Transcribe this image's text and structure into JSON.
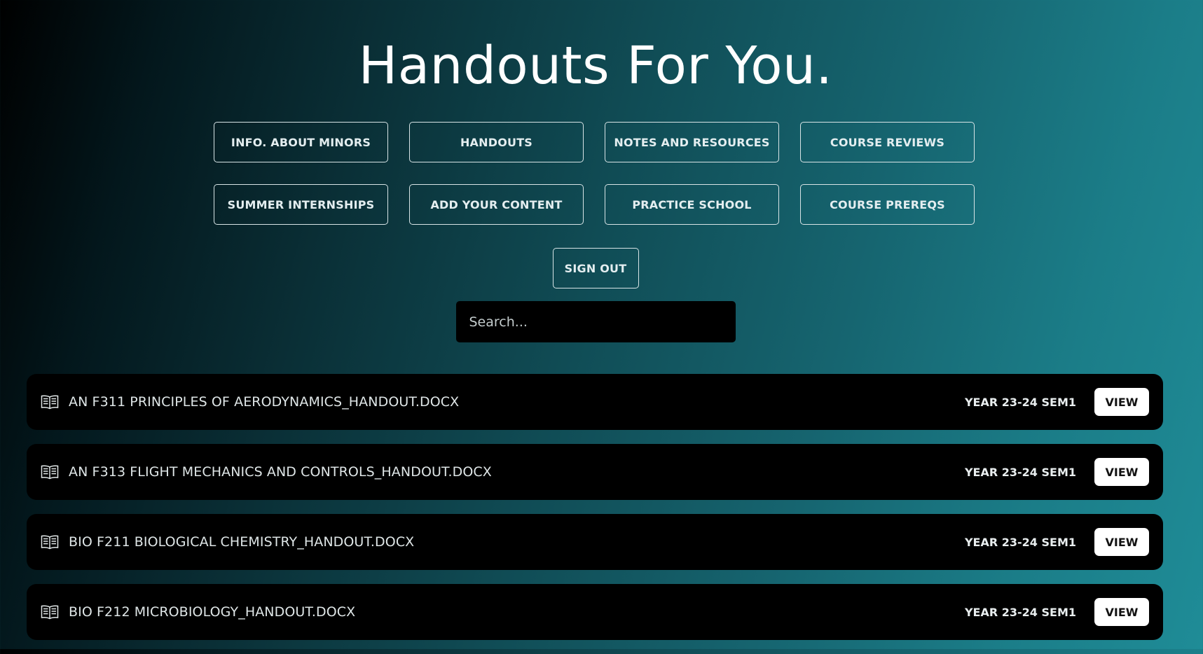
{
  "header": {
    "title": "Handouts For You."
  },
  "nav": {
    "buttons": [
      {
        "label": "INFO. ABOUT MINORS"
      },
      {
        "label": "HANDOUTS"
      },
      {
        "label": "NOTES AND RESOURCES"
      },
      {
        "label": "COURSE REVIEWS"
      },
      {
        "label": "SUMMER INTERNSHIPS"
      },
      {
        "label": "ADD YOUR CONTENT"
      },
      {
        "label": "PRACTICE SCHOOL"
      },
      {
        "label": "COURSE PREREQS"
      }
    ],
    "sign_out_label": "SIGN OUT"
  },
  "search": {
    "placeholder": "Search...",
    "value": ""
  },
  "handouts": [
    {
      "name": "AN F311 PRINCIPLES OF AERODYNAMICS_HANDOUT.DOCX",
      "term": "YEAR 23-24 SEM1",
      "action": "VIEW",
      "icon": "book-icon"
    },
    {
      "name": "AN F313 FLIGHT MECHANICS AND CONTROLS_HANDOUT.DOCX",
      "term": "YEAR 23-24 SEM1",
      "action": "VIEW",
      "icon": "book-icon"
    },
    {
      "name": "BIO F211 BIOLOGICAL CHEMISTRY_HANDOUT.DOCX",
      "term": "YEAR 23-24 SEM1",
      "action": "VIEW",
      "icon": "book-icon"
    },
    {
      "name": "BIO F212 MICROBIOLOGY_HANDOUT.DOCX",
      "term": "YEAR 23-24 SEM1",
      "action": "VIEW",
      "icon": "book-icon"
    }
  ],
  "colors": {
    "row_background": "#000000",
    "view_button": "#ffffff",
    "gradient_start": "#000000",
    "gradient_end": "#1f8c97"
  }
}
